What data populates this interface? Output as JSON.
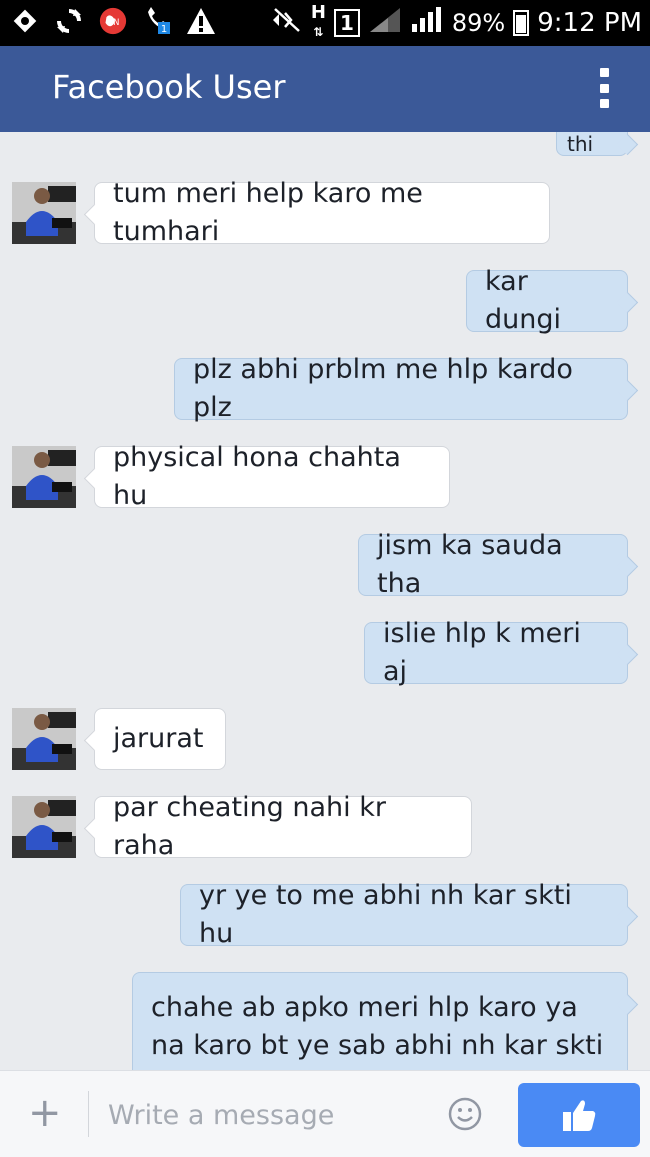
{
  "status_bar": {
    "battery": "89%",
    "time": "9:12 PM",
    "network_label": "H",
    "sim_label": "1",
    "call_label": "ON",
    "icons": [
      "location-icon",
      "sync-icon",
      "call-recording-icon",
      "call-forward-icon",
      "warning-icon",
      "mute-icon",
      "network-h-icon",
      "sim-icon",
      "signal-icon",
      "battery-icon"
    ]
  },
  "header": {
    "title": "Facebook User",
    "menu_icon": "overflow-menu-icon"
  },
  "conversation": {
    "truncated_top_text": "thi",
    "messages": [
      {
        "sender": "other",
        "text": "tum meri help karo me tumhari"
      },
      {
        "sender": "me",
        "text": "kar dungi"
      },
      {
        "sender": "me",
        "text": "plz abhi prblm me hlp kardo plz"
      },
      {
        "sender": "other",
        "text": "physical hona chahta hu"
      },
      {
        "sender": "me",
        "text": "jism ka sauda tha"
      },
      {
        "sender": "me",
        "text": "islie hlp k meri aj"
      },
      {
        "sender": "other",
        "text": "jarurat"
      },
      {
        "sender": "other",
        "text": "par cheating nahi kr raha"
      },
      {
        "sender": "me",
        "text": "yr ye to me abhi nh kar skti hu"
      },
      {
        "sender": "me",
        "text": "chahe ab apko meri hlp karo ya na karo bt ye sab abhi nh kar skti"
      }
    ]
  },
  "composer": {
    "placeholder": "Write a message",
    "value": "",
    "add_icon": "plus-icon",
    "emoji_icon": "smiley-icon",
    "send_icon": "thumbs-up-icon"
  },
  "colors": {
    "header_bg": "#3b5998",
    "incoming_bubble": "#ffffff",
    "outgoing_bubble": "#cfe1f3",
    "like_button": "#4a8af4",
    "chat_bg": "#e9ebee"
  }
}
